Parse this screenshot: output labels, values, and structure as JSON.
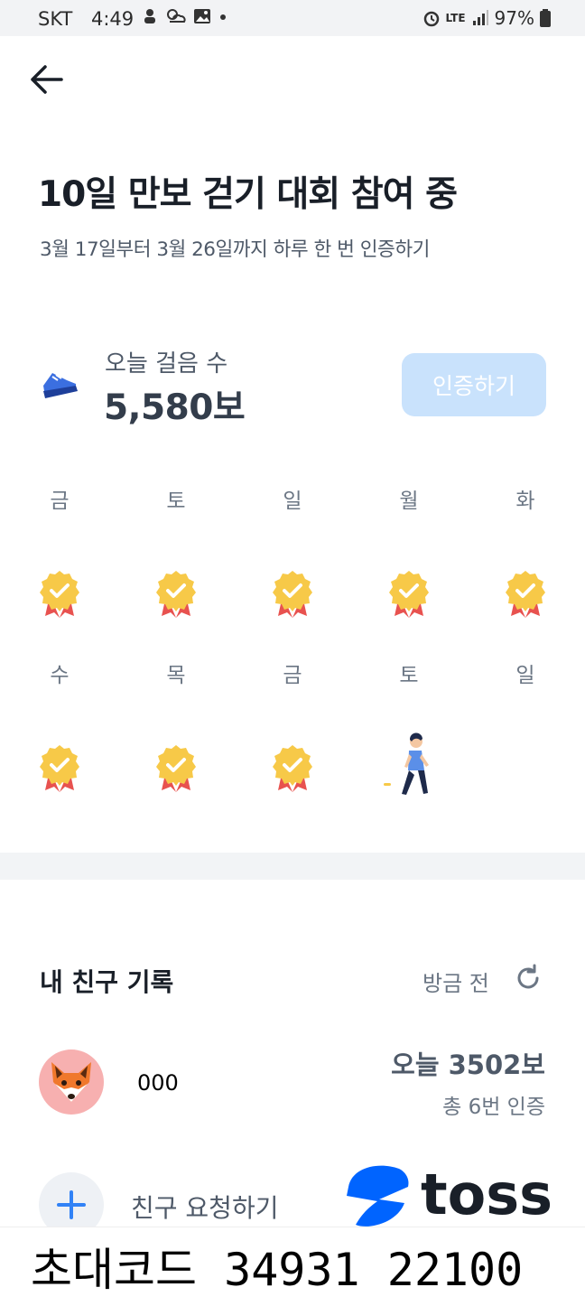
{
  "status_bar": {
    "carrier": "SKT",
    "time": "4:49",
    "network": "LTE",
    "battery": "97%"
  },
  "header": {
    "back_icon": "arrow-left-icon"
  },
  "challenge": {
    "title": "10일 만보 걷기 대회 참여 중",
    "subtitle": "3월 17일부터 3월 26일까지 하루 한 번 인증하기"
  },
  "today": {
    "label": "오늘 걸음 수",
    "steps": "5,580보",
    "verify_button": "인증하기",
    "icon": "sneaker-icon"
  },
  "calendar": {
    "days": [
      {
        "label": "금",
        "status": "done"
      },
      {
        "label": "토",
        "status": "done"
      },
      {
        "label": "일",
        "status": "done"
      },
      {
        "label": "월",
        "status": "done"
      },
      {
        "label": "화",
        "status": "done"
      },
      {
        "label": "수",
        "status": "done"
      },
      {
        "label": "목",
        "status": "done"
      },
      {
        "label": "금",
        "status": "done"
      },
      {
        "label": "토",
        "status": "today"
      },
      {
        "label": "일",
        "status": "upcoming"
      }
    ]
  },
  "friends": {
    "title": "내 친구 기록",
    "refresh_label": "방금 전",
    "items": [
      {
        "name": "000",
        "today": "오늘 3502보",
        "total": "총 6번 인증",
        "avatar": "fox-icon"
      }
    ],
    "add_label": "친구 요청하기"
  },
  "brand": {
    "name": "toss",
    "color": "#191f28",
    "accent": "#0064ff"
  },
  "invite": {
    "text": "초대코드 34931 22100"
  },
  "colors": {
    "badge_gold": "#f7c948",
    "ribbon_red": "#e8524f",
    "verify_disabled": "#c9e2fc"
  }
}
